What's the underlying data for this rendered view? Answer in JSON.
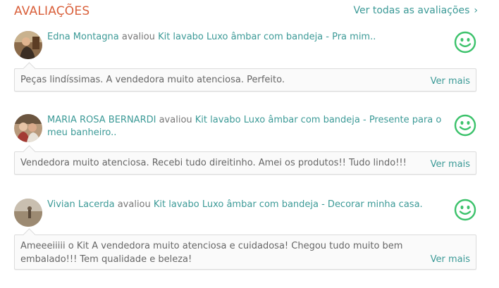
{
  "header": {
    "title": "AVALIAÇÕES",
    "see_all": "Ver todas as avaliações",
    "see_all_chevron": "›"
  },
  "colors": {
    "title": "#d9603b",
    "link": "#3c9a97",
    "smiley": "#3cc26b"
  },
  "reviews": [
    {
      "user": "Edna Montagna",
      "verb": "avaliou",
      "product_title": "Kit lavabo Luxo âmbar com bandeja - Pra mim..",
      "comment": "Peças lindíssimas. A vendedora muito atenciosa. Perfeito.",
      "more": "Ver mais",
      "rating_icon": "smiley-happy-icon"
    },
    {
      "user": "MARIA ROSA BERNARDI",
      "verb": "avaliou",
      "product_title": "Kit lavabo Luxo âmbar com bandeja - Presente para o meu banheiro..",
      "comment": "Vendedora muito atenciosa. Recebi tudo direitinho. Amei os produtos!! Tudo lindo!!!",
      "more": "Ver mais",
      "rating_icon": "smiley-happy-icon"
    },
    {
      "user": "Vivian Lacerda",
      "verb": "avaliou",
      "product_title": "Kit lavabo Luxo âmbar com bandeja - Decorar minha casa.",
      "comment": "Ameeeiiiii o Kit A vendedora muito atenciosa e cuidadosa! Chegou tudo muito bem embalado!!! Tem qualidade e beleza!",
      "more": "Ver mais",
      "rating_icon": "smiley-happy-icon"
    }
  ]
}
